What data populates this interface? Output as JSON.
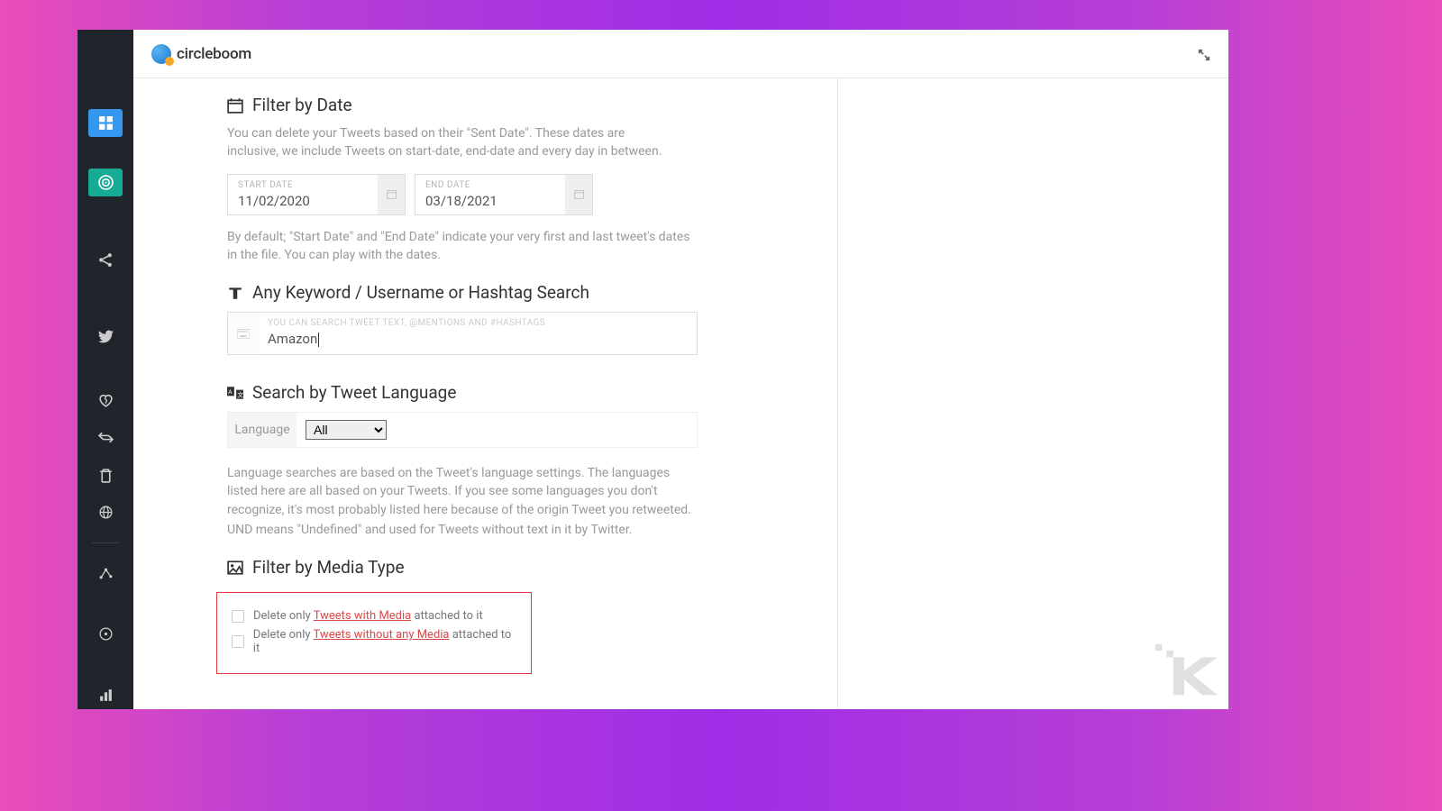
{
  "brand": {
    "name": "circleboom"
  },
  "sections": {
    "filterDate": {
      "title": "Filter by Date",
      "desc": "You can delete your Tweets based on their \"Sent Date\". These dates are inclusive, we include Tweets on start-date, end-date and every day in between.",
      "startLabel": "START DATE",
      "startValue": "11/02/2020",
      "endLabel": "END DATE",
      "endValue": "03/18/2021",
      "footnote": "By default; \"Start Date\" and \"End Date\" indicate your very first and last tweet's dates in the file. You can play with the dates."
    },
    "keyword": {
      "title": "Any Keyword / Username or Hashtag Search",
      "placeholder": "YOU CAN SEARCH TWEET TEXT, @MENTIONS AND #HASHTAGS",
      "value": "Amazon"
    },
    "language": {
      "title": "Search by Tweet Language",
      "label": "Language",
      "selected": "All",
      "desc1": "Language searches are based on the Tweet's language settings. The languages listed here are all based on your Tweets. If you see some languages you don't recognize, it's most probably listed here because of the origin Tweet you retweeted.",
      "desc2": "UND means \"Undefined\" and used for Tweets without text in it by Twitter."
    },
    "media": {
      "title": "Filter by Media Type",
      "opt1_pre": "Delete only ",
      "opt1_link": "Tweets with Media",
      "opt1_post": " attached to it",
      "opt2_pre": "Delete only ",
      "opt2_link": "Tweets without any Media",
      "opt2_post": " attached to it"
    }
  }
}
